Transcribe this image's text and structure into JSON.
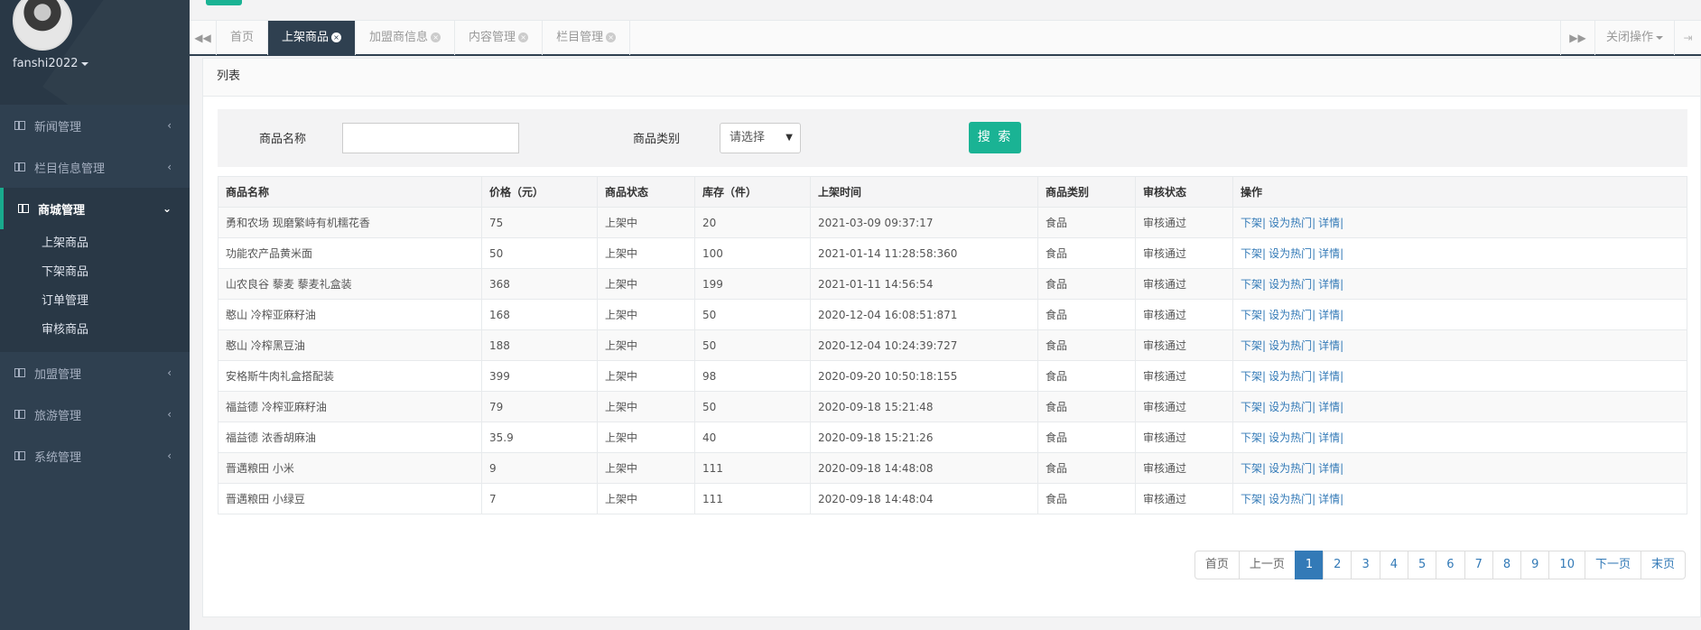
{
  "user": {
    "name": "fanshi2022"
  },
  "sidebar": {
    "items": [
      {
        "label": "新闻管理",
        "arrow": "‹"
      },
      {
        "label": "栏目信息管理",
        "arrow": "‹"
      },
      {
        "label": "商城管理",
        "arrow": "⌄",
        "active": true
      },
      {
        "label": "加盟管理",
        "arrow": "‹"
      },
      {
        "label": "旅游管理",
        "arrow": "‹"
      },
      {
        "label": "系统管理",
        "arrow": "‹"
      }
    ],
    "sub_items": [
      "上架商品",
      "下架商品",
      "订单管理",
      "审核商品"
    ]
  },
  "tabs": [
    {
      "label": "首页",
      "closable": false
    },
    {
      "label": "上架商品",
      "closable": true,
      "active": true
    },
    {
      "label": "加盟商信息",
      "closable": true
    },
    {
      "label": "内容管理",
      "closable": true
    },
    {
      "label": "栏目管理",
      "closable": true
    }
  ],
  "toolbar": {
    "close_ops": "关闭操作"
  },
  "panel": {
    "title": "列表"
  },
  "search": {
    "name_label": "商品名称",
    "name_value": "",
    "category_label": "商品类别",
    "category_selected": "请选择",
    "button": "搜 索"
  },
  "table": {
    "headers": [
      "商品名称",
      "价格（元）",
      "商品状态",
      "库存（件）",
      "上架时间",
      "商品类别",
      "审核状态",
      "操作"
    ],
    "rows": [
      [
        "勇和农场 现磨繁峙有机糯花香",
        "75",
        "上架中",
        "20",
        "2021-03-09 09:37:17",
        "食品",
        "审核通过"
      ],
      [
        "功能农产品黄米面",
        "50",
        "上架中",
        "100",
        "2021-01-14 11:28:58:360",
        "食品",
        "审核通过"
      ],
      [
        "山农良谷 藜麦 藜麦礼盒装",
        "368",
        "上架中",
        "199",
        "2021-01-11 14:56:54",
        "食品",
        "审核通过"
      ],
      [
        "憨山 冷榨亚麻籽油",
        "168",
        "上架中",
        "50",
        "2020-12-04 16:08:51:871",
        "食品",
        "审核通过"
      ],
      [
        "憨山 冷榨黑豆油",
        "188",
        "上架中",
        "50",
        "2020-12-04 10:24:39:727",
        "食品",
        "审核通过"
      ],
      [
        "安格斯牛肉礼盒搭配装",
        "399",
        "上架中",
        "98",
        "2020-09-20 10:50:18:155",
        "食品",
        "审核通过"
      ],
      [
        "福益德 冷榨亚麻籽油",
        "79",
        "上架中",
        "50",
        "2020-09-18 15:21:48",
        "食品",
        "审核通过"
      ],
      [
        "福益德 浓香胡麻油",
        "35.9",
        "上架中",
        "40",
        "2020-09-18 15:21:26",
        "食品",
        "审核通过"
      ],
      [
        "晋邁粮田 小米",
        "9",
        "上架中",
        "111",
        "2020-09-18 14:48:08",
        "食品",
        "审核通过"
      ],
      [
        "晋邁粮田 小绿豆",
        "7",
        "上架中",
        "111",
        "2020-09-18 14:48:04",
        "食品",
        "审核通过"
      ]
    ],
    "actions": [
      "下架",
      "设为热门",
      "详情"
    ]
  },
  "pagination": {
    "first": "首页",
    "prev": "上一页",
    "pages": [
      "1",
      "2",
      "3",
      "4",
      "5",
      "6",
      "7",
      "8",
      "9",
      "10"
    ],
    "current": "1",
    "next": "下一页",
    "last": "末页"
  }
}
